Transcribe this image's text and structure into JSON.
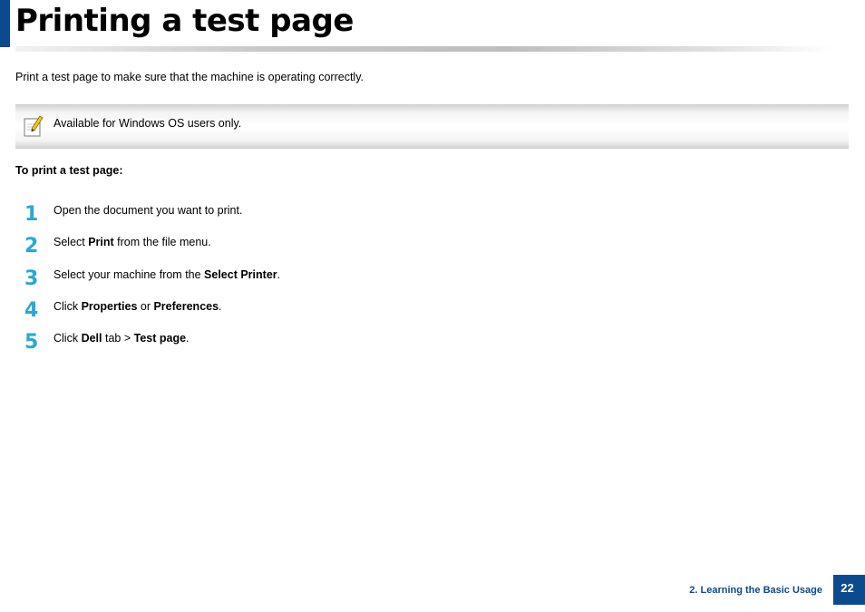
{
  "header": {
    "title": "Printing a test page"
  },
  "intro": "Print a test page to make sure that the machine is operating correctly.",
  "note": {
    "icon": "note-pencil-icon",
    "text": "Available for Windows OS users only."
  },
  "procedure": {
    "heading": "To print a test page:",
    "steps": [
      {
        "number": "1",
        "pre": "Open the document you want to print.",
        "b1": "",
        "mid": "",
        "b2": "",
        "post": ""
      },
      {
        "number": "2",
        "pre": "Select ",
        "b1": "Print",
        "mid": " from the file menu.",
        "b2": "",
        "post": ""
      },
      {
        "number": "3",
        "pre": "Select your machine from the ",
        "b1": "Select Printer",
        "mid": ".",
        "b2": "",
        "post": ""
      },
      {
        "number": "4",
        "pre": "Click ",
        "b1": "Properties",
        "mid": " or ",
        "b2": "Preferences",
        "post": "."
      },
      {
        "number": "5",
        "pre": "Click ",
        "b1": "Dell",
        "mid": " tab > ",
        "b2": "Test page",
        "post": "."
      }
    ]
  },
  "footer": {
    "section": "2.  Learning the Basic Usage",
    "page": "22"
  },
  "colors": {
    "accent": "#0b4a8f",
    "step_number": "#2aa6d8"
  }
}
